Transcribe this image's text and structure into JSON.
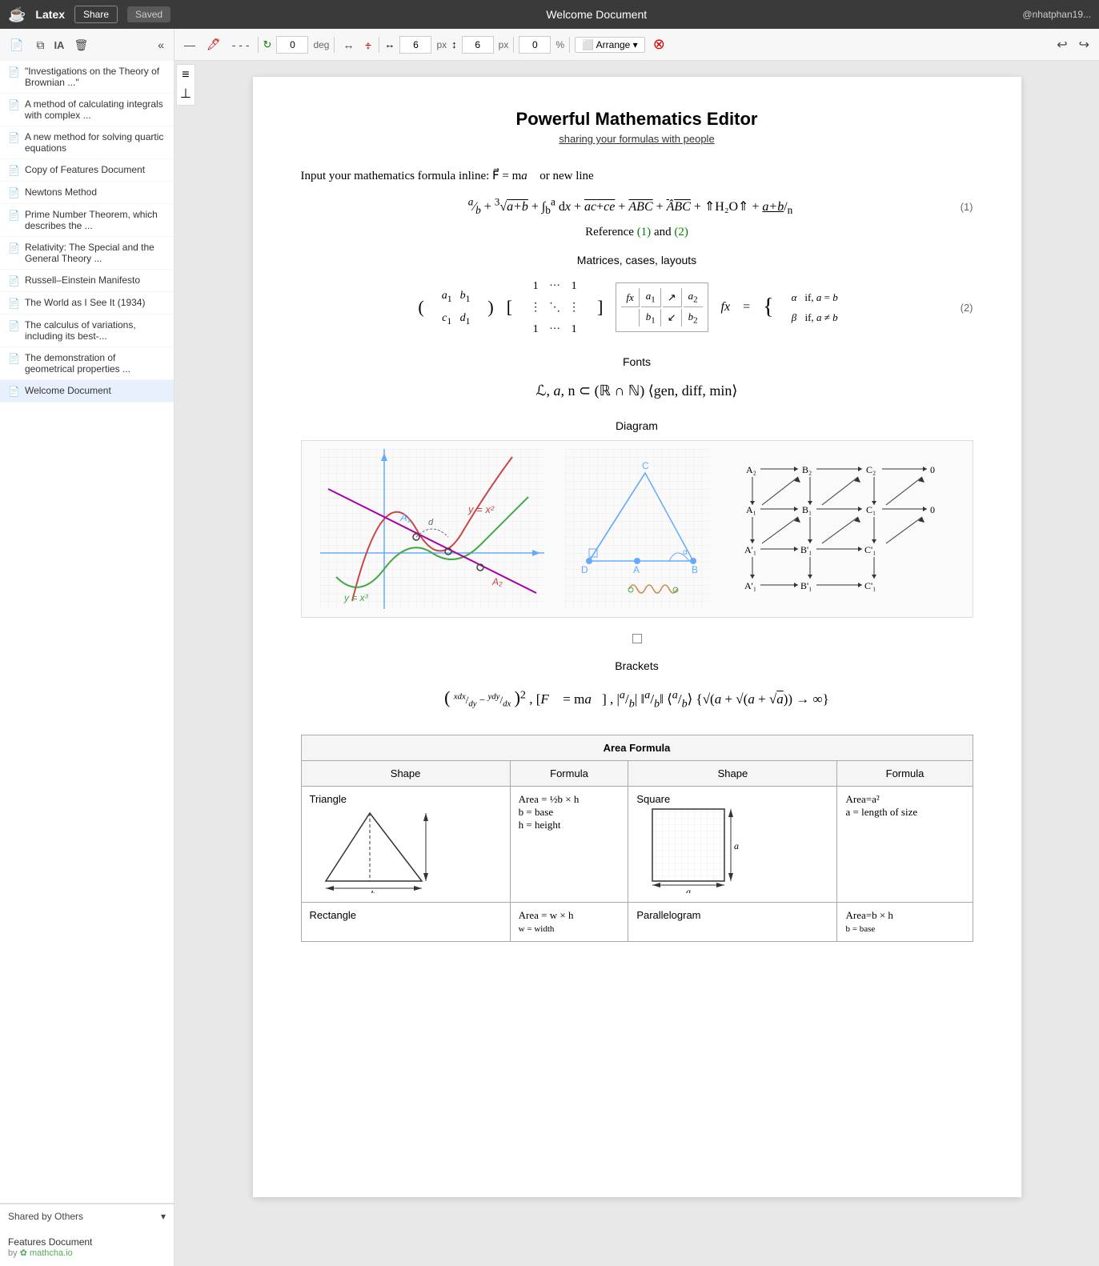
{
  "topbar": {
    "logo": "☕",
    "app_name": "Latex",
    "share_label": "Share",
    "saved_label": "Saved",
    "title": "Welcome Document",
    "user": "@nhatphan19..."
  },
  "toolbar": {
    "rotate_value": "0",
    "rotate_unit": "deg",
    "width_value": "6",
    "px1": "px",
    "height_value": "6",
    "px2": "px",
    "scale_value": "0",
    "scale_unit": "%",
    "arrange_label": "Arrange"
  },
  "sidebar": {
    "docs": [
      {
        "title": "\"Investigations on the Theory of Brownian ...\""
      },
      {
        "title": "A method of calculating integrals with complex ..."
      },
      {
        "title": "A new method for solving quartic equations"
      },
      {
        "title": "Copy of Features Document"
      },
      {
        "title": "Newtons Method"
      },
      {
        "title": "Prime Number Theorem, which describes the ..."
      },
      {
        "title": "Relativity: The Special and the General Theory ..."
      },
      {
        "title": "Russell–Einstein Manifesto"
      },
      {
        "title": "The World as I See It (1934)"
      },
      {
        "title": "The calculus of variations, including its best-..."
      },
      {
        "title": "The demonstration of geometrical properties ..."
      },
      {
        "title": "Welcome Document"
      }
    ],
    "shared_section": "Shared by Others",
    "shared_docs": [
      {
        "title": "Features Document",
        "by": "by",
        "author": "mathcha.io"
      }
    ]
  },
  "document": {
    "title": "Powerful Mathematics Editor",
    "subtitle": "sharing your formulas with people",
    "sections": {
      "inline_label": "Input your mathematics formula inline:",
      "matrices_label": "Matrices, cases, layouts",
      "fonts_label": "Fonts",
      "diagram_label": "Diagram",
      "brackets_label": "Brackets",
      "area_formula_label": "Area Formula"
    },
    "table": {
      "headers": [
        "Shape",
        "Formula",
        "Shape",
        "Formula"
      ],
      "rows": [
        {
          "shape1": "Triangle",
          "formula1": "Area = ½b × h\nb = base\nh = height",
          "shape2": "Square",
          "formula2": "Area=a²\na = length of size"
        },
        {
          "shape1": "Rectangle",
          "formula1": "Area = w × h\nw = width",
          "shape2": "Parallelogram",
          "formula2": "Area=b × h\nb = base"
        }
      ]
    }
  }
}
